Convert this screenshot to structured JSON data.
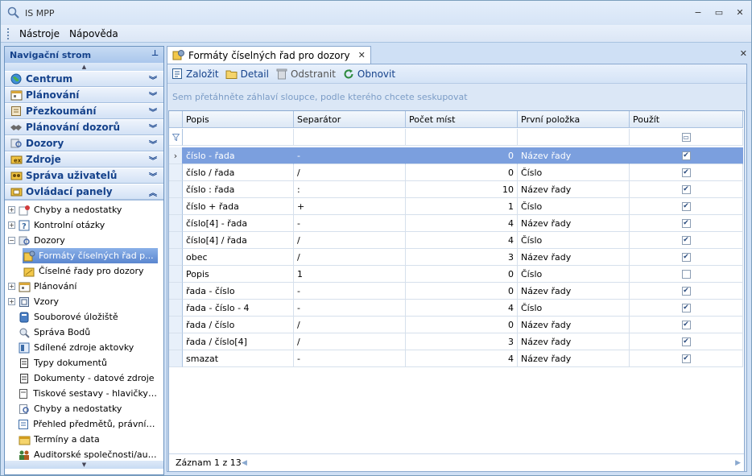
{
  "window": {
    "title": "IS MPP",
    "buttons": {
      "minimize": "−",
      "maximize": "▭",
      "close": "✕"
    }
  },
  "menu": [
    "Nástroje",
    "Nápověda"
  ],
  "nav": {
    "title": "Navigační strom",
    "groups": [
      {
        "label": "Centrum",
        "icon": "globe-icon"
      },
      {
        "label": "Plánování",
        "icon": "calendar-icon"
      },
      {
        "label": "Přezkoumání",
        "icon": "document-icon"
      },
      {
        "label": "Plánování dozorů",
        "icon": "handshake-icon"
      },
      {
        "label": "Dozory",
        "icon": "inspect-icon"
      },
      {
        "label": "Zdroje",
        "icon": "resource-icon"
      },
      {
        "label": "Správa uživatelů",
        "icon": "users-icon"
      },
      {
        "label": "Ovládací panely",
        "icon": "folder-icon"
      }
    ],
    "tree": [
      {
        "label": "Chyby a nedostatky",
        "icon": "bug-icon",
        "expander": "+"
      },
      {
        "label": "Kontrolní otázky",
        "icon": "question-icon",
        "expander": "+"
      },
      {
        "label": "Dozory",
        "icon": "inspect-icon",
        "expander": "−"
      },
      {
        "label": "Formáty číselných řad p...",
        "icon": "format-icon"
      },
      {
        "label": "Číselné řady pro dozory",
        "icon": "series-icon"
      },
      {
        "label": "Plánování",
        "icon": "calendar-icon",
        "expander": "+"
      },
      {
        "label": "Vzory",
        "icon": "template-icon",
        "expander": "+"
      },
      {
        "label": "Souborové úložiště",
        "icon": "storage-icon"
      },
      {
        "label": "Správa Bodů",
        "icon": "points-icon"
      },
      {
        "label": "Sdílené zdroje aktovky",
        "icon": "shared-icon"
      },
      {
        "label": "Typy dokumentů",
        "icon": "doc-type-icon"
      },
      {
        "label": "Dokumenty - datové zdroje",
        "icon": "doc-source-icon"
      },
      {
        "label": "Tiskové sestavy - hlavičky a...",
        "icon": "print-icon"
      },
      {
        "label": "Chyby a nedostatky",
        "icon": "search-icon"
      },
      {
        "label": "Přehled předmětů, právních...",
        "icon": "list-icon"
      },
      {
        "label": "Termíny a data",
        "icon": "date-icon"
      },
      {
        "label": "Auditorské společnosti/audi...",
        "icon": "auditor-icon"
      }
    ]
  },
  "tab": {
    "label": "Formáty číselných řad pro dozory",
    "close": "✕"
  },
  "toolbar": {
    "create": "Založit",
    "detail": "Detail",
    "remove": "Odstranit",
    "refresh": "Obnovit"
  },
  "grid": {
    "group_hint": "Sem přetáhněte záhlaví sloupce, podle kterého chcete seskupovat",
    "columns": [
      "Popis",
      "Separátor",
      "Počet míst",
      "První položka",
      "Použít"
    ],
    "rows": [
      {
        "popis": "číslo - řada",
        "sep": "-",
        "count": "0",
        "first": "Název řady",
        "use": true
      },
      {
        "popis": "číslo / řada",
        "sep": "/",
        "count": "0",
        "first": "Číslo",
        "use": true
      },
      {
        "popis": "číslo : řada",
        "sep": ":",
        "count": "10",
        "first": "Název řady",
        "use": true
      },
      {
        "popis": "číslo + řada",
        "sep": "+",
        "count": "1",
        "first": "Číslo",
        "use": true
      },
      {
        "popis": "číslo[4] - řada",
        "sep": "-",
        "count": "4",
        "first": "Název řady",
        "use": true
      },
      {
        "popis": "číslo[4] / řada",
        "sep": "/",
        "count": "4",
        "first": "Číslo",
        "use": true
      },
      {
        "popis": "obec",
        "sep": "/",
        "count": "3",
        "first": "Název řady",
        "use": true
      },
      {
        "popis": "Popis",
        "sep": "1",
        "count": "0",
        "first": "Číslo",
        "use": false
      },
      {
        "popis": "řada - číslo",
        "sep": "-",
        "count": "0",
        "first": "Název řady",
        "use": true
      },
      {
        "popis": "řada - číslo - 4",
        "sep": "-",
        "count": "4",
        "first": "Číslo",
        "use": true
      },
      {
        "popis": "řada / číslo",
        "sep": "/",
        "count": "0",
        "first": "Název řady",
        "use": true
      },
      {
        "popis": "řada / číslo[4]",
        "sep": "/",
        "count": "3",
        "first": "Název řady",
        "use": true
      },
      {
        "popis": "smazat",
        "sep": "-",
        "count": "4",
        "first": "Název řady",
        "use": true
      }
    ],
    "status": "Záznam 1 z 13"
  }
}
